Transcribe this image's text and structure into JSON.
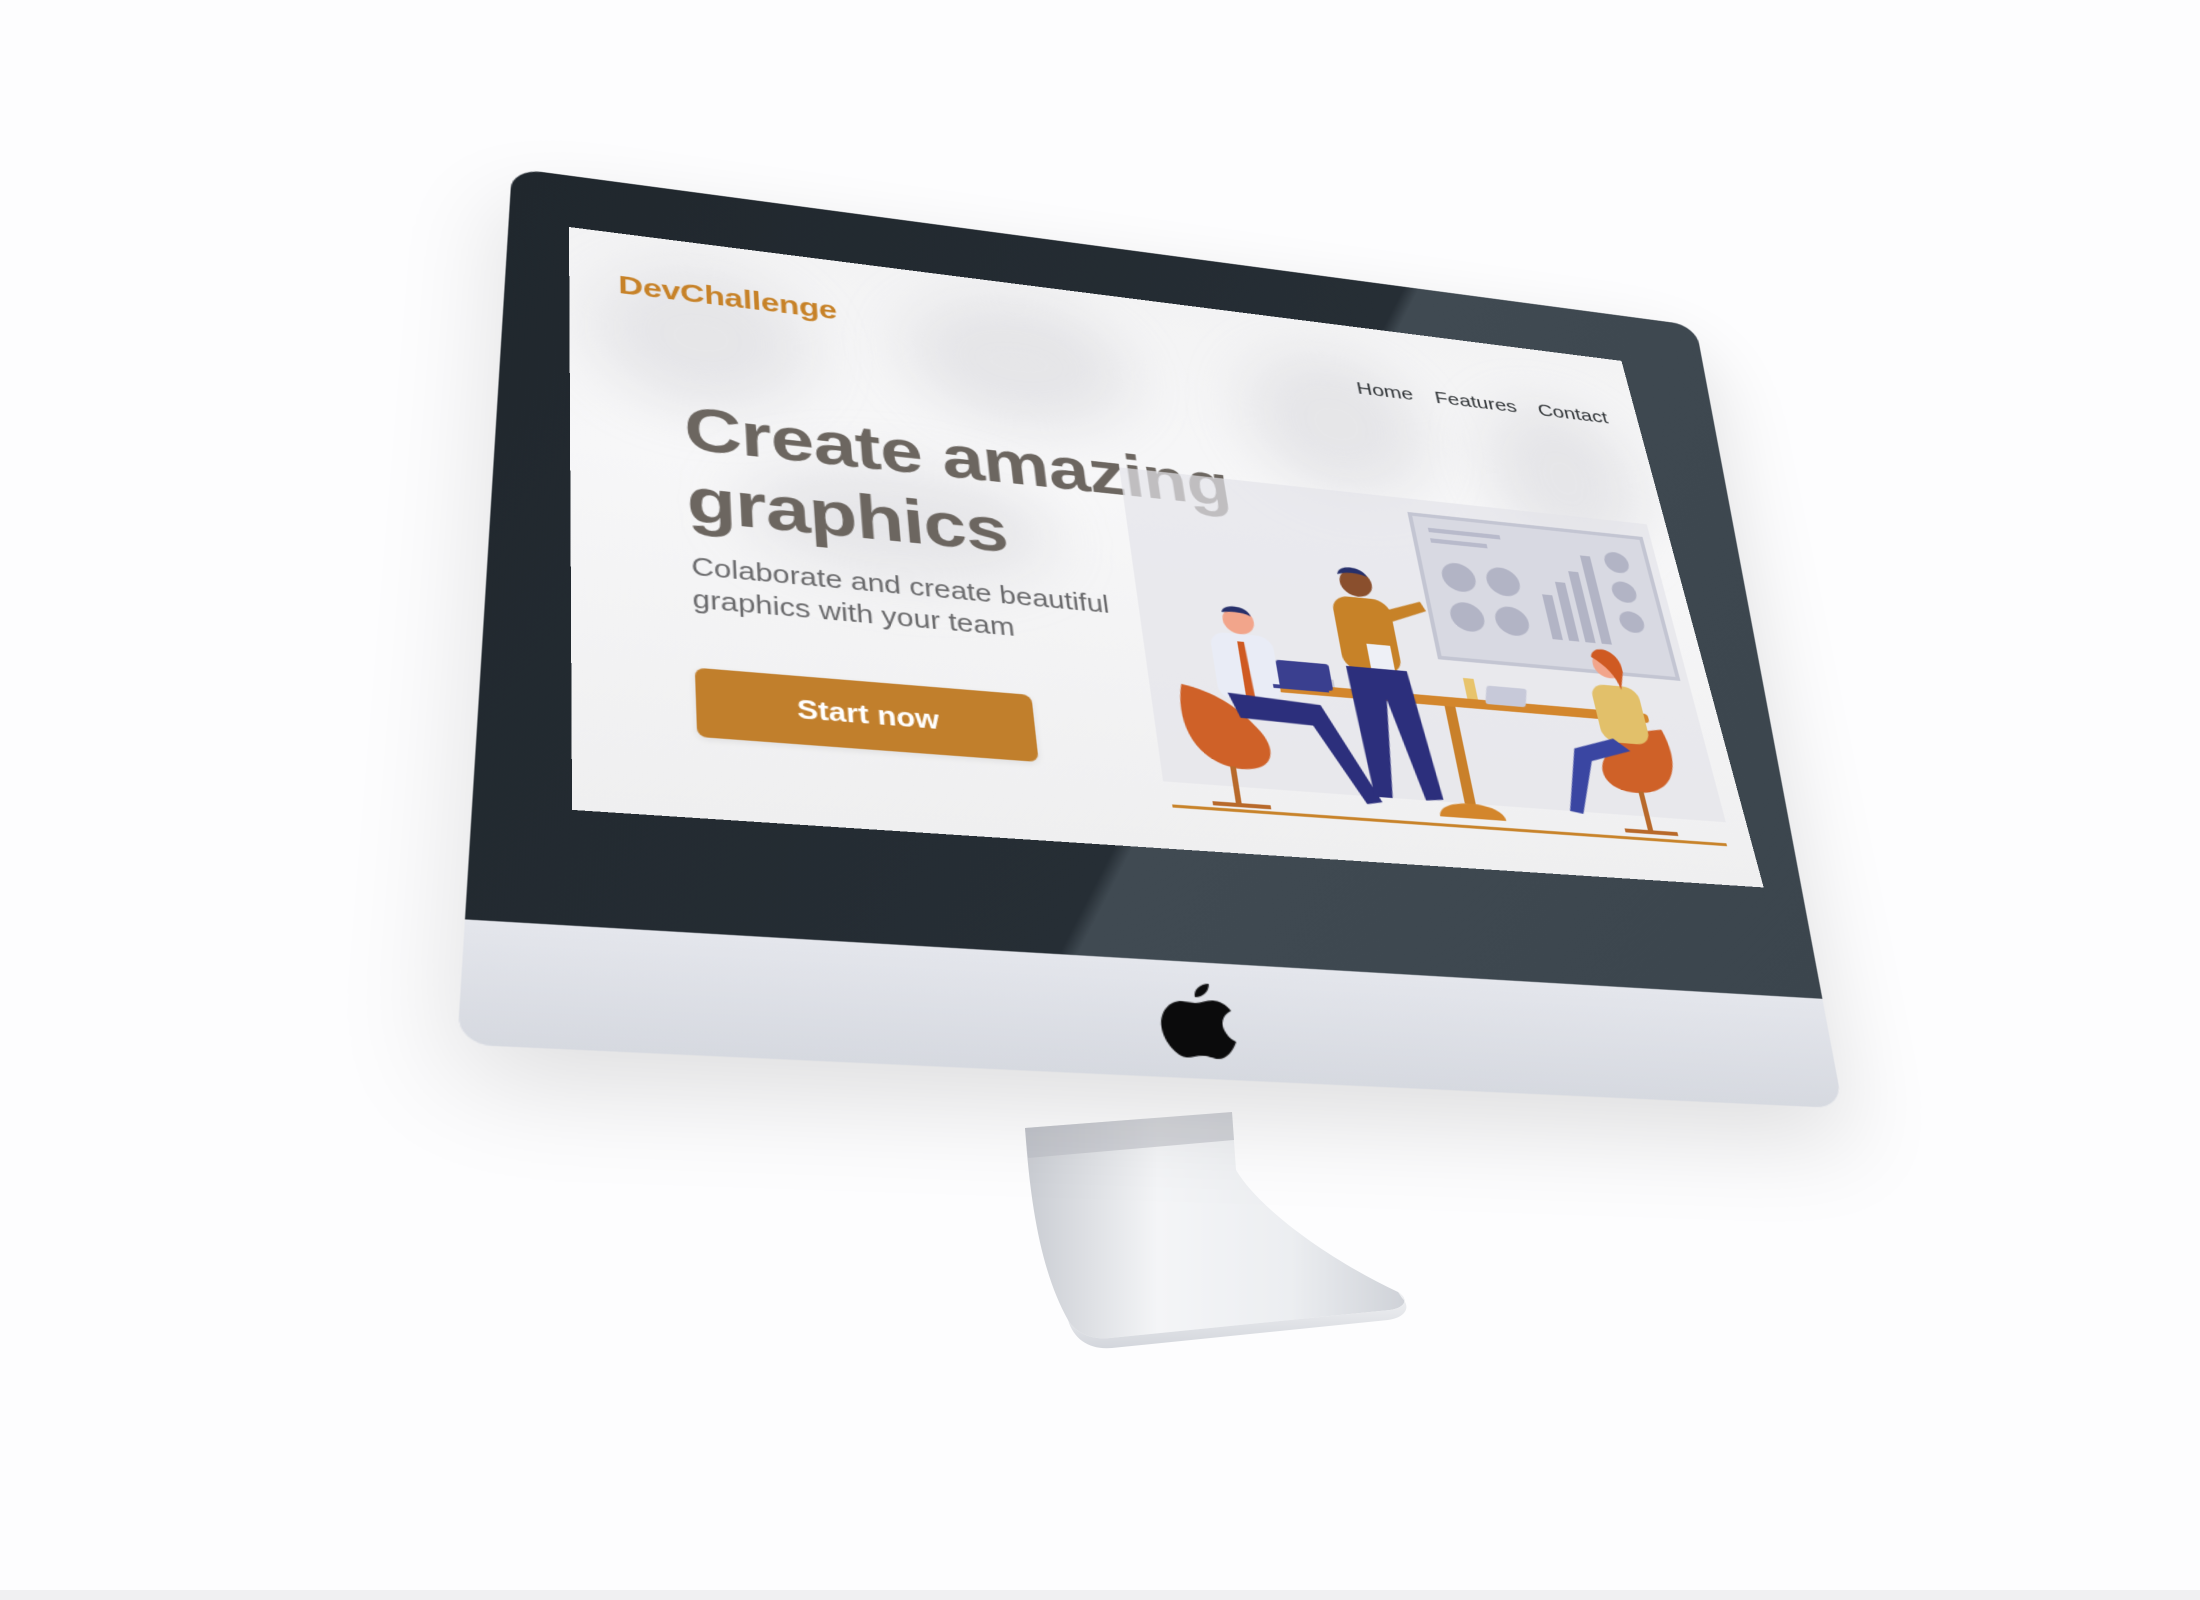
{
  "website": {
    "brand": "DevChallenge",
    "nav": {
      "items": [
        {
          "label": "Home"
        },
        {
          "label": "Features"
        },
        {
          "label": "Contact"
        }
      ]
    },
    "hero": {
      "title": "Create amazing graphics",
      "subtitle": "Colaborate and create beautiful graphics with your team",
      "cta_label": "Start now"
    }
  },
  "colors": {
    "brand_accent": "#c78228",
    "button_fill": "#c17f2c",
    "heading_text": "#6c6660",
    "nav_text": "#2f3336",
    "bezel": "#20272d",
    "chin": "#dfe2e8"
  },
  "icons": {
    "device_logo": "apple-icon"
  }
}
